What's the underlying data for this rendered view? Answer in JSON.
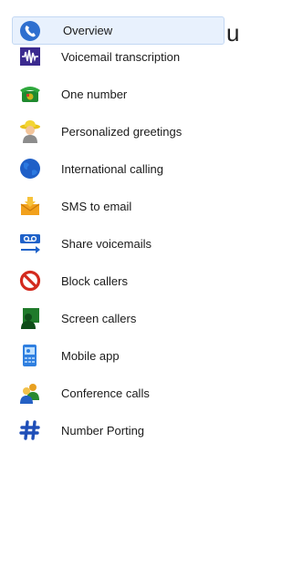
{
  "sidebar": {
    "items": [
      {
        "label": "Overview",
        "icon": "phone-handset-icon",
        "active": true
      },
      {
        "label": "Voicemail transcription",
        "icon": "waveform-icon"
      },
      {
        "label": "One number",
        "icon": "phone-icon"
      },
      {
        "label": "Personalized greetings",
        "icon": "person-icon"
      },
      {
        "label": "International calling",
        "icon": "globe-icon"
      },
      {
        "label": "SMS to email",
        "icon": "mail-icon"
      },
      {
        "label": "Share voicemails",
        "icon": "voicemail-share-icon"
      },
      {
        "label": "Block callers",
        "icon": "block-icon"
      },
      {
        "label": "Screen callers",
        "icon": "screen-caller-icon"
      },
      {
        "label": "Mobile app",
        "icon": "mobile-app-icon"
      },
      {
        "label": "Conference calls",
        "icon": "conference-icon"
      },
      {
        "label": "Number Porting",
        "icon": "hash-icon"
      }
    ]
  },
  "main": {
    "clipped_text": "u"
  },
  "colors": {
    "active_bg": "#e8f1fd",
    "active_border": "#c3d8f3"
  }
}
